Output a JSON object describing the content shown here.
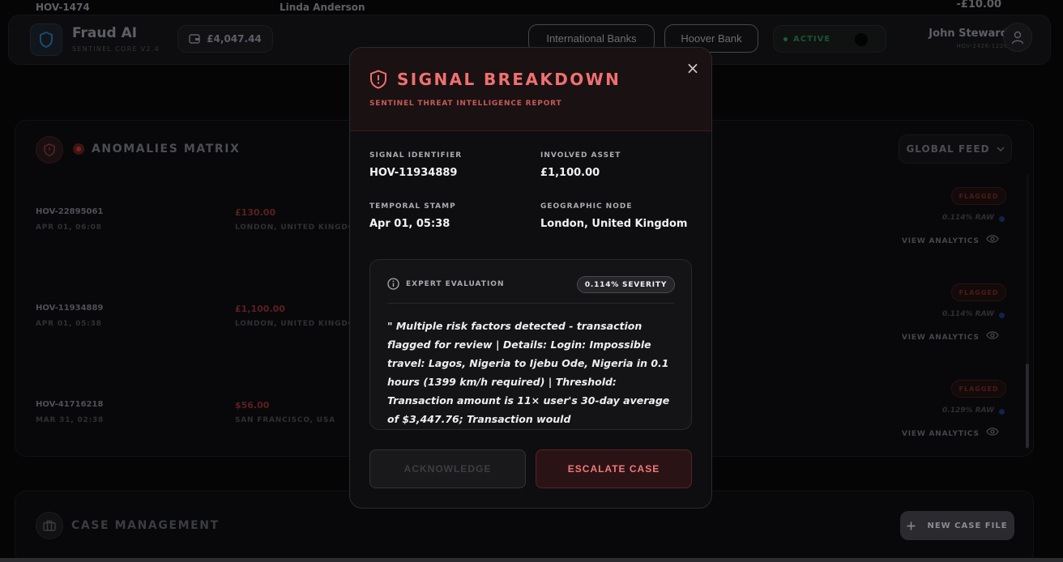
{
  "top_strip": {
    "ref": "HOV-1474",
    "name": "Linda Anderson",
    "amount": "-£10.00"
  },
  "header": {
    "brand": "Fraud AI",
    "brand_sub": "SENTINEL CORE V2.4",
    "balance": "£4,047.44",
    "bank_buttons": [
      "International Banks",
      "Hoover Bank"
    ],
    "status": "ACTIVE",
    "user_name": "John Steward",
    "user_id": "HOV-2426-1226"
  },
  "anomalies": {
    "title": "ANOMALIES MATRIX",
    "feed_label": "GLOBAL FEED",
    "rows": [
      {
        "id": "HOV-22895061",
        "date": "APR 01, 06:08",
        "amount": "£130.00",
        "location": "LONDON, UNITED KINGDO",
        "flag": "FLAGGED",
        "raw": "0.114% RAW",
        "action": "VIEW ANALYTICS"
      },
      {
        "id": "HOV-11934889",
        "date": "APR 01, 05:38",
        "amount": "£1,100.00",
        "location": "LONDON, UNITED KINGDO",
        "flag": "FLAGGED",
        "raw": "0.114% RAW",
        "action": "VIEW ANALYTICS"
      },
      {
        "id": "HOV-41716218",
        "date": "MAR 31, 02:38",
        "amount": "$56.00",
        "location": "SAN FRANCISCO, USA",
        "flag": "FLAGGED",
        "raw": "0.129% RAW",
        "action": "VIEW ANALYTICS"
      }
    ]
  },
  "case_management": {
    "title": "CASE MANAGEMENT",
    "new_case_label": "NEW CASE FILE"
  },
  "modal": {
    "title": "SIGNAL BREAKDOWN",
    "subtitle": "SENTINEL THREAT INTELLIGENCE REPORT",
    "close": "×",
    "fields": {
      "signal_identifier": {
        "label": "SIGNAL IDENTIFIER",
        "value": "HOV-11934889"
      },
      "involved_asset": {
        "label": "INVOLVED ASSET",
        "value": "£1,100.00"
      },
      "temporal_stamp": {
        "label": "TEMPORAL STAMP",
        "value": "Apr 01, 05:38"
      },
      "geographic_node": {
        "label": "GEOGRAPHIC NODE",
        "value": "London, United Kingdom"
      }
    },
    "evaluation": {
      "label": "EXPERT EVALUATION",
      "severity": "0.114% SEVERITY",
      "text": "\" Multiple risk factors detected - transaction flagged for review | Details: Login: Impossible travel: Lagos, Nigeria to Ijebu Ode, Nigeria in 0.1 hours (1399 km/h required) | Threshold: Transaction amount is 11× user's 30-day average of $3,447.76; Transaction would"
    },
    "acknowledge_label": "ACKNOWLEDGE",
    "escalate_label": "ESCALATE CASE"
  },
  "colors": {
    "accent_red": "#f07070",
    "background": "#000000",
    "modal_bg": "#0e0e10"
  }
}
